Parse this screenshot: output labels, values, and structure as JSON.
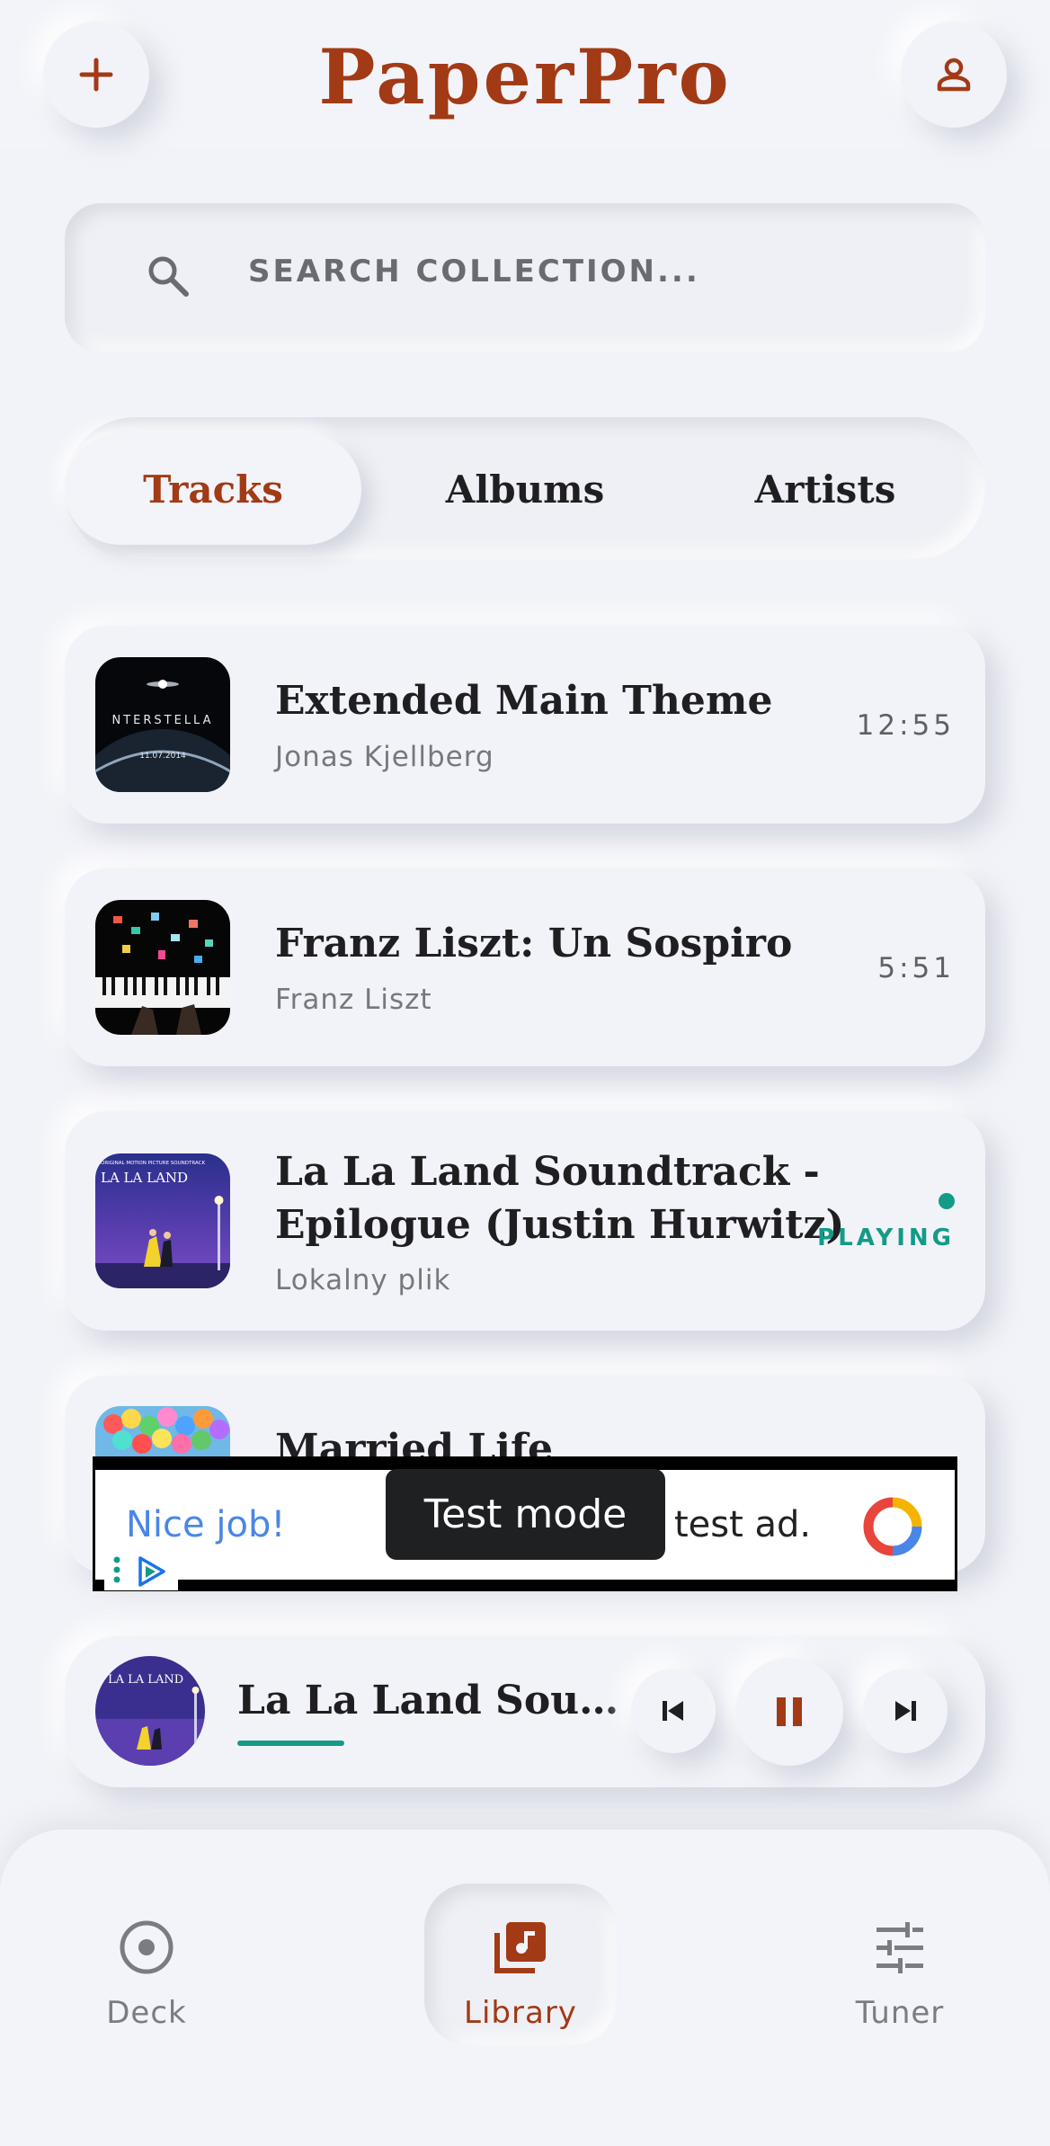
{
  "app": {
    "title": "PaperPro"
  },
  "header": {
    "add_icon": "plus-icon",
    "profile_icon": "person-icon"
  },
  "search": {
    "placeholder": "SEARCH COLLECTION...",
    "value": ""
  },
  "tabs": [
    {
      "label": "Tracks",
      "active": true
    },
    {
      "label": "Albums",
      "active": false
    },
    {
      "label": "Artists",
      "active": false
    }
  ],
  "tracks": [
    {
      "title": "Extended Main Theme",
      "artist": "Jonas Kjellberg",
      "duration": "12:55",
      "art_text": [
        "NTERSTELLA",
        "11.07.2014"
      ]
    },
    {
      "title": "Franz Liszt: Un Sospiro",
      "artist": "Franz Liszt",
      "duration": "5:51"
    },
    {
      "title_line1": "La La Land Soundtrack -",
      "title_line2": "Epilogue (Justin Hurwitz)",
      "artist": "Lokalny plik",
      "status": "PLAYING",
      "art_text": [
        "ORIGINAL MOTION PICTURE SOUNDTRACK",
        "LA LA LAND"
      ]
    },
    {
      "title": "Married Life",
      "artist": ""
    }
  ],
  "ad": {
    "headline": "Nice job!",
    "body": "test ad.",
    "tooltip": "Test mode"
  },
  "player": {
    "title": "La La Land Soundtr...",
    "progress": 0.27,
    "state": "playing",
    "art_text": "LA LA LAND"
  },
  "nav": [
    {
      "label": "Deck",
      "icon": "disc-icon",
      "active": false
    },
    {
      "label": "Library",
      "icon": "library-music-icon",
      "active": true
    },
    {
      "label": "Tuner",
      "icon": "tune-sliders-icon",
      "active": false
    }
  ],
  "colors": {
    "accent": "#a23a15",
    "playing": "#139b87",
    "background": "#f2f3f8"
  }
}
